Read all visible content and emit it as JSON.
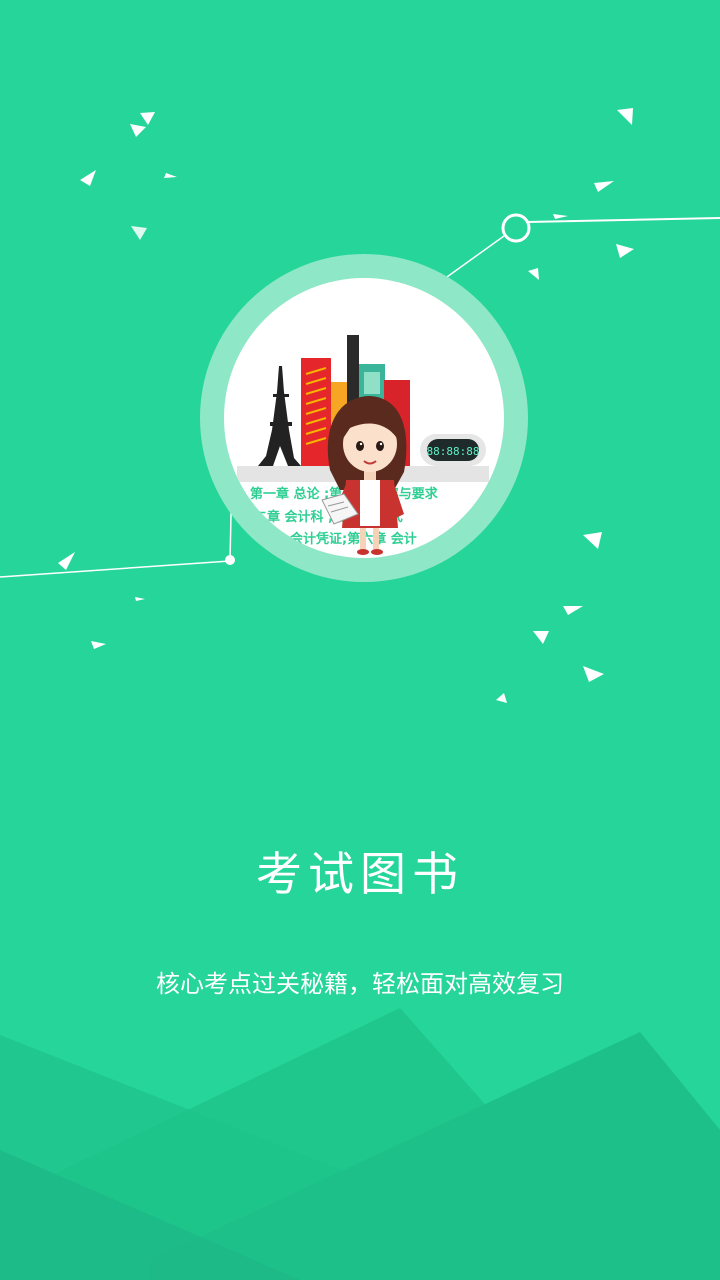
{
  "colors": {
    "background": "#25d59a",
    "mountain_dark": "#1fbf88",
    "mountain_mid": "#22c993",
    "ring": "#8ee8c8",
    "accent_text": "#2fcf94"
  },
  "illustration": {
    "strip_lines": [
      "第一章 总论 ;第 核算内容与要求",
      "二章 会计科 ;第四章 复式",
      "会计凭证;第六章 会计"
    ],
    "clock_display": "88:88:88"
  },
  "onboarding": {
    "title": "考试图书",
    "subtitle": "核心考点过关秘籍，轻松面对高效复习"
  }
}
